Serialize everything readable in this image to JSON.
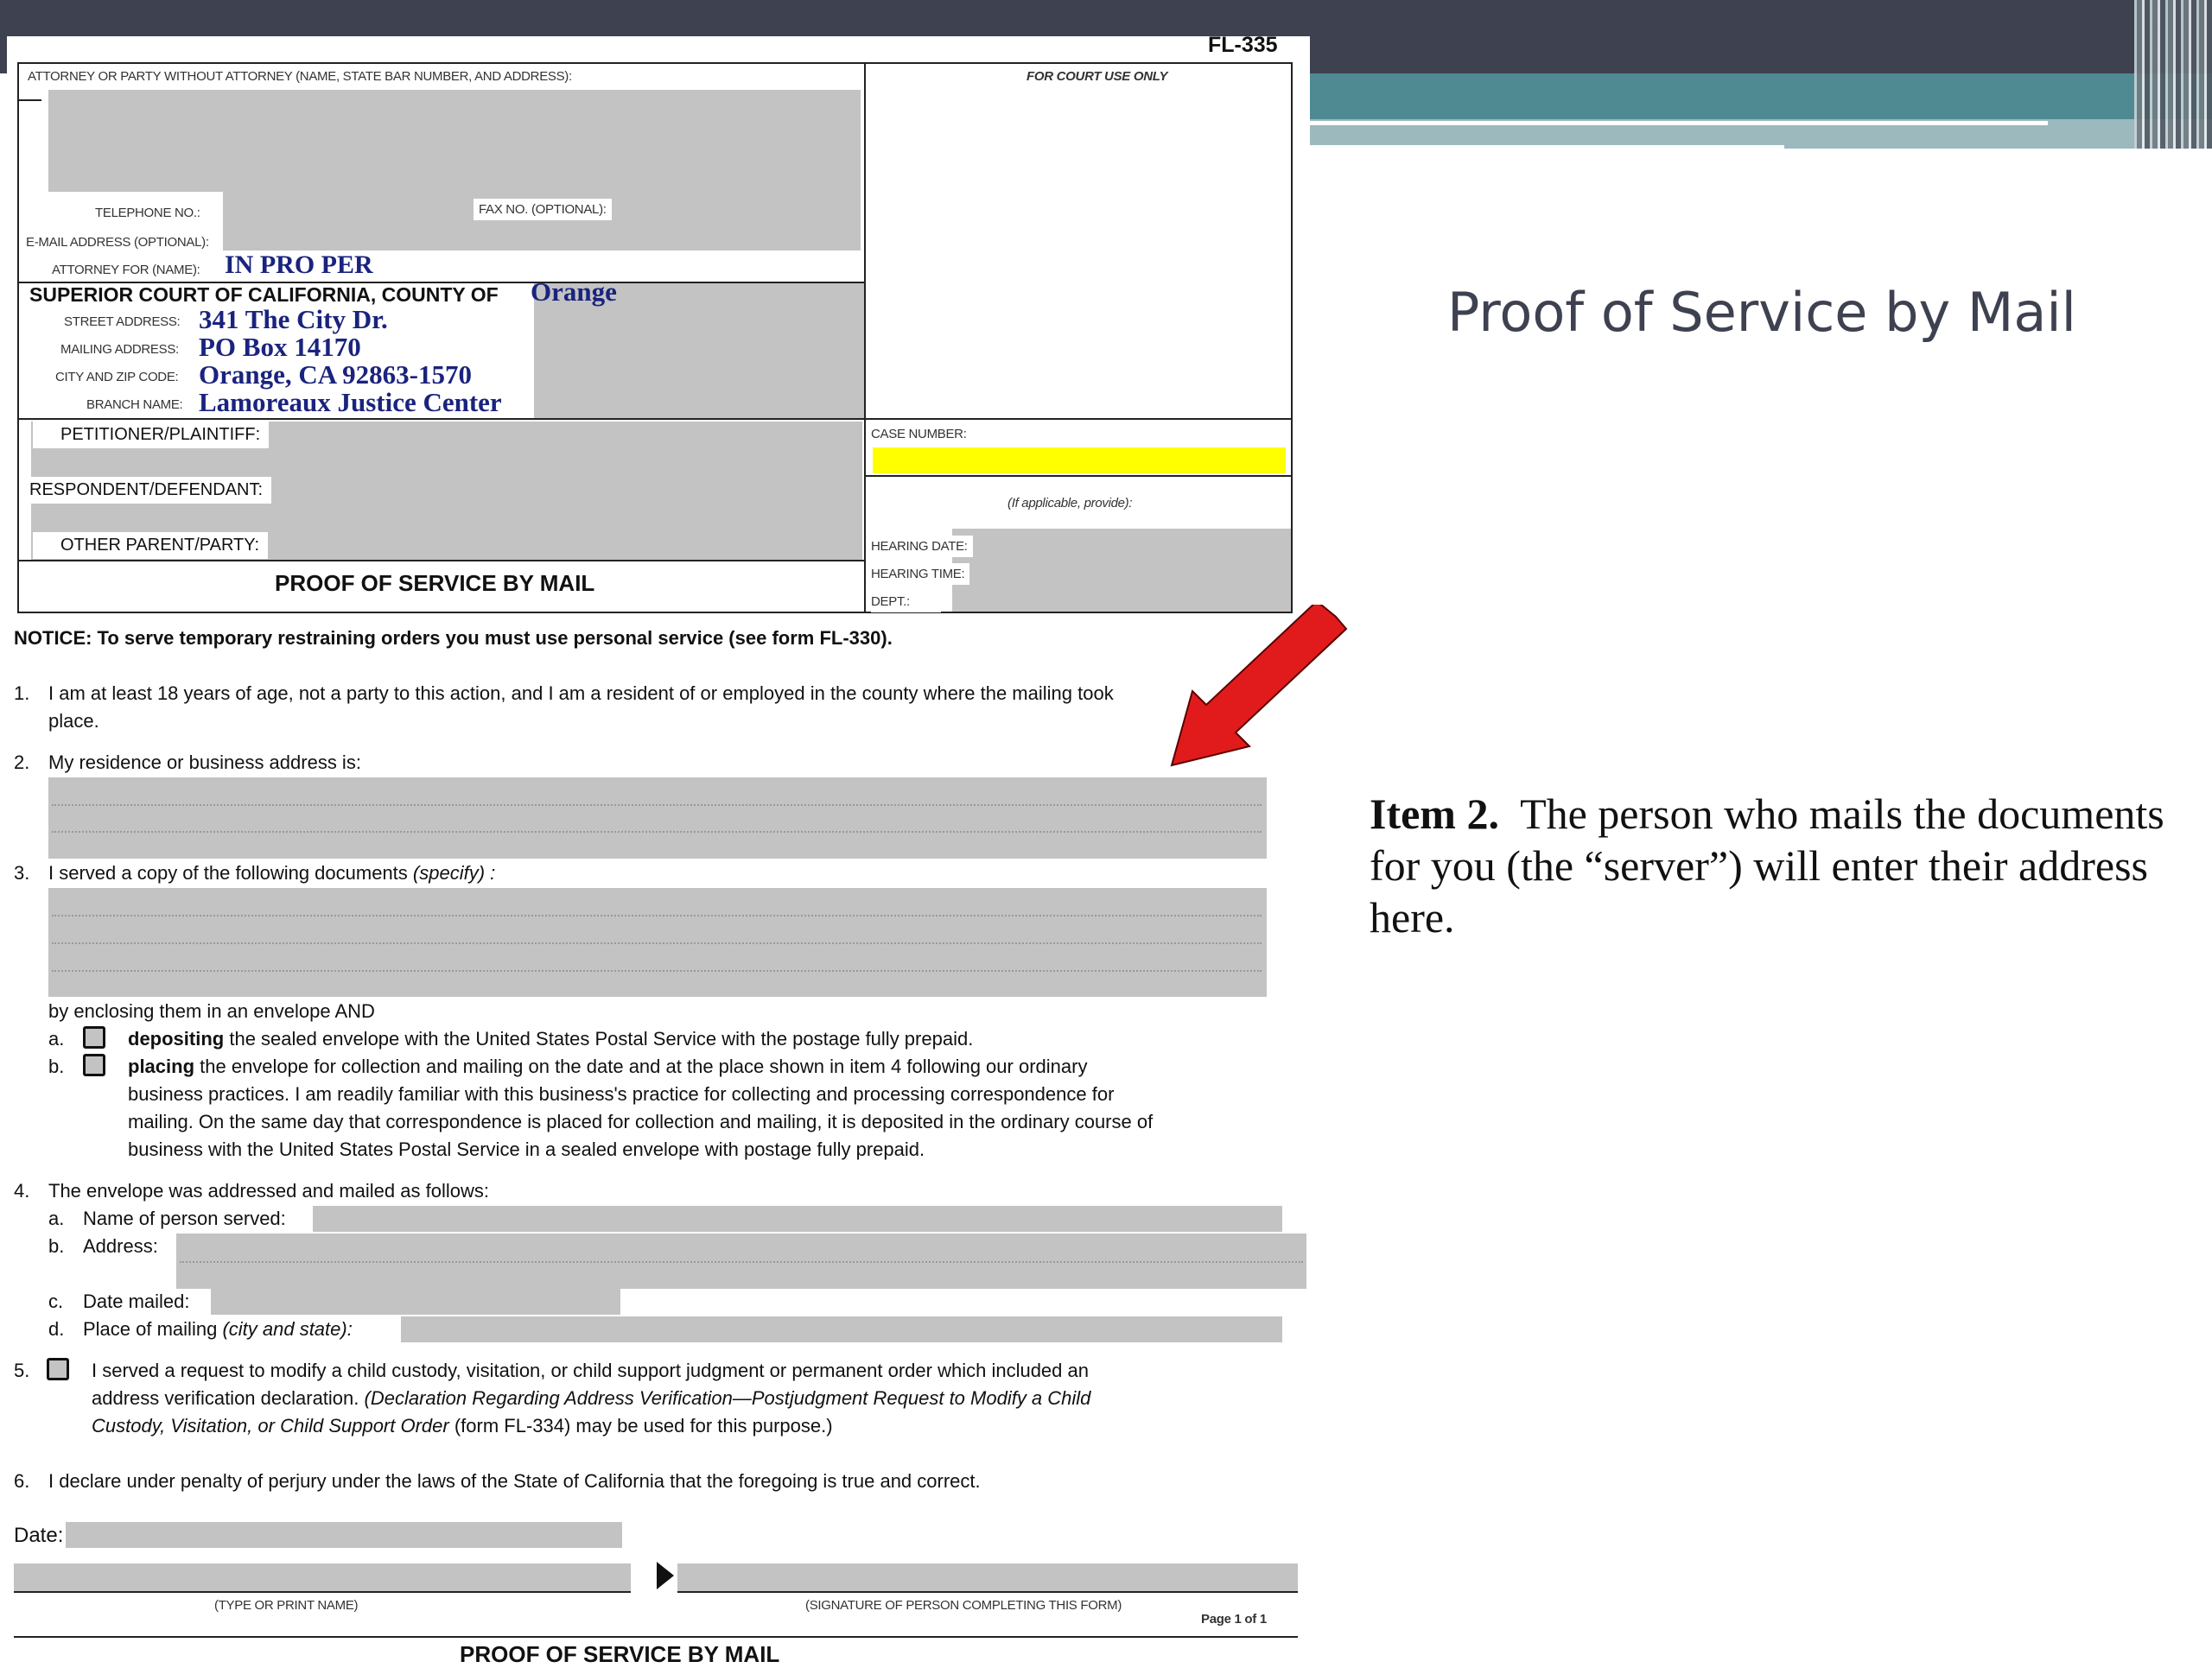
{
  "slide": {
    "title": "Proof of Service by Mail",
    "caption_bold": "Item 2.",
    "caption_text": "The person who mails the documents for you  (the “server”) will enter their address here."
  },
  "form": {
    "form_id": "FL-335",
    "attorney_label": "ATTORNEY OR PARTY WITHOUT ATTORNEY (Name, State Bar number, and address):",
    "court_use": "FOR COURT USE ONLY",
    "telephone": "TELEPHONE NO.:",
    "fax": "FAX NO. (Optional):",
    "email": "E-MAIL ADDRESS (Optional):",
    "attorney_for": "ATTORNEY FOR (Name):",
    "attorney_for_value": "IN PRO PER",
    "court_label": "SUPERIOR COURT OF CALIFORNIA, COUNTY OF",
    "county": "Orange",
    "street_label": "STREET ADDRESS:",
    "street": "341 The City Dr.",
    "mailing_label": "MAILING ADDRESS:",
    "mailing": "PO Box 14170",
    "city_label": "CITY AND ZIP CODE:",
    "city": "Orange, CA  92863-1570",
    "branch_label": "BRANCH NAME:",
    "branch": "Lamoreaux Justice Center",
    "petitioner": "PETITIONER/PLAINTIFF:",
    "respondent": "RESPONDENT/DEFENDANT:",
    "other_parent": "OTHER PARENT/PARTY:",
    "case_number": "CASE NUMBER:",
    "if_applicable": "(If applicable, provide):",
    "hearing_date": "HEARING DATE:",
    "hearing_time": "HEARING TIME:",
    "dept": "DEPT.:",
    "form_title": "PROOF OF SERVICE BY MAIL",
    "notice": "NOTICE: To serve temporary restraining orders you must use personal service (see form FL-330).",
    "item1_num": "1.",
    "item1_line1": "I am at least 18 years of age, not a party to this action, and I am a resident of or employed in the county where the mailing took",
    "item1_line2": "place.",
    "item2_num": "2.",
    "item2": "My residence or business address is:",
    "item3_num": "3.",
    "item3": "I served a copy of the following documents",
    "item3_specify": "(specify) :",
    "enclosing": "by enclosing them in an envelope AND",
    "a_letter": "a.",
    "a_bold": "depositing",
    "a_text": "the sealed envelope with the United States Postal Service with the postage fully prepaid.",
    "b_letter": "b.",
    "b_bold": "placing",
    "b_text1": "the envelope for collection and mailing on the date and at the place shown in item 4 following our ordinary",
    "b_text2": "business practices. I am readily familiar with this business's practice for collecting and processing correspondence for",
    "b_text3": "mailing. On the same day that correspondence is placed for collection and mailing, it is deposited in the ordinary course of",
    "b_text4": "business with the United States Postal Service in a sealed envelope with postage fully prepaid.",
    "item4_num": "4.",
    "item4": "The envelope was addressed and mailed as follows:",
    "item4a_letter": "a.",
    "item4a": "Name of person served:",
    "item4b_letter": "b.",
    "item4b": "Address:",
    "item4c_letter": "c.",
    "item4c": "Date mailed:",
    "item4d_letter": "d.",
    "item4d": "Place of mailing",
    "item4d_it": "(city and state):",
    "item5_num": "5.",
    "item5_line1": "I served a request to modify a child custody, visitation, or child support judgment or permanent order which included an",
    "item5_line2a": "address verification declaration.",
    "item5_line2b": "(Declaration Regarding Address Verification—Postjudgment Request to Modify a Child",
    "item5_line3a": "Custody, Visitation, or Child Support Order",
    "item5_line3b": "(form FL-334) may be used for this purpose.)",
    "item6_num": "6.",
    "item6": "I declare under penalty of perjury under the laws of the State of California that the foregoing is true and correct.",
    "date_label": "Date:",
    "print_name": "(TYPE OR PRINT NAME)",
    "signature": "(SIGNATURE OF PERSON COMPLETING THIS FORM)",
    "page": "Page 1 of 1",
    "footer_title": "PROOF OF SERVICE BY MAIL"
  },
  "colors": {
    "band_dark": "#3e4150",
    "band_teal": "#4f8a92",
    "arrow": "#e11b1b",
    "case_highlight": "#ffff00",
    "field_gray": "#c3c3c3",
    "blue_text": "#1a237e"
  }
}
